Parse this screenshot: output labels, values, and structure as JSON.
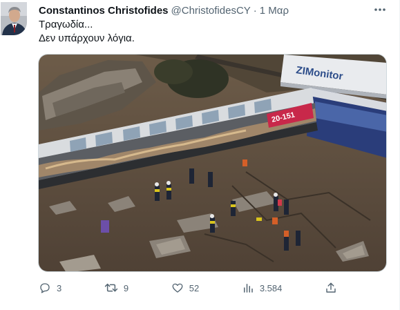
{
  "author": {
    "name": "Constantinos Christofides",
    "handle": "@ChristofidesCY",
    "separator": "·",
    "date": "1 Μαρ"
  },
  "tweet": {
    "line1": "Τραγωδία...",
    "line2": "Δεν υπάρχουν λόγια."
  },
  "media": {
    "banner_text": "ZIMonitor",
    "car_number": "20-151",
    "alt": ""
  },
  "actions": {
    "replies": "3",
    "retweets": "9",
    "likes": "52",
    "views": "3.584"
  },
  "colors": {
    "text_primary": "#0f1419",
    "text_secondary": "#536471",
    "border": "#cfd9de"
  },
  "icons": {
    "more": "more-dots-icon",
    "reply": "reply-icon",
    "retweet": "retweet-icon",
    "like": "heart-icon",
    "views": "views-chart-icon",
    "share": "share-icon"
  }
}
